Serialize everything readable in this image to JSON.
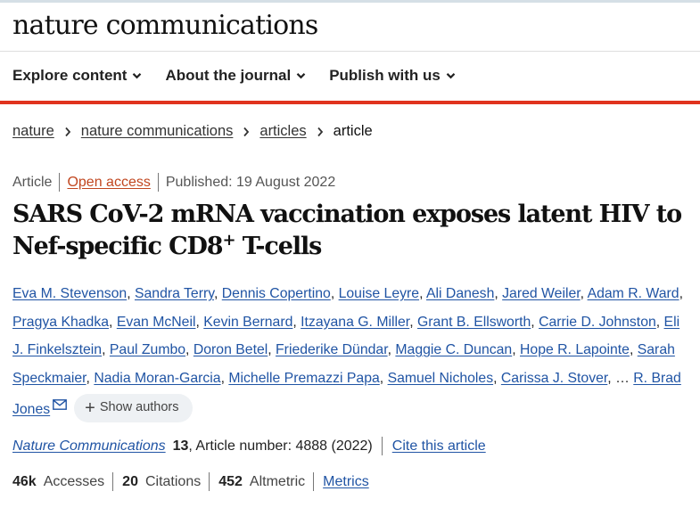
{
  "brand": {
    "name": "nature communications"
  },
  "nav": {
    "items": [
      {
        "label": "Explore content"
      },
      {
        "label": "About the journal"
      },
      {
        "label": "Publish with us"
      }
    ]
  },
  "breadcrumb": {
    "items": [
      "nature",
      "nature communications",
      "articles"
    ],
    "current": "article"
  },
  "meta": {
    "type": "Article",
    "access": "Open access",
    "published": "Published: 19 August 2022"
  },
  "title": {
    "part1": "SARS CoV-2 mRNA vaccination exposes latent HIV to Nef-specific CD8",
    "sup": "+",
    "part2": " T-cells"
  },
  "authors": {
    "list": [
      "Eva M. Stevenson",
      "Sandra Terry",
      "Dennis Copertino",
      "Louise Leyre",
      "Ali Danesh",
      "Jared Weiler",
      "Adam R. Ward",
      "Pragya Khadka",
      "Evan McNeil",
      "Kevin Bernard",
      "Itzayana G. Miller",
      "Grant B. Ellsworth",
      "Carrie D. Johnston",
      "Eli J. Finkelsztein",
      "Paul Zumbo",
      "Doron Betel",
      "Friederike Dündar",
      "Maggie C. Duncan",
      "Hope R. Lapointe",
      "Sarah Speckmaier",
      "Nadia Moran-Garcia",
      "Michelle Premazzi Papa",
      "Samuel Nicholes",
      "Carissa J. Stover"
    ],
    "ellipsis": "…",
    "corresponding": "R. Brad Jones",
    "show_label": "Show authors"
  },
  "citation": {
    "journal": "Nature Communications",
    "volume": "13",
    "article_info": ", Article number: 4888 (2022)",
    "cite_label": "Cite this article"
  },
  "metrics": {
    "accesses_count": "46k",
    "accesses_label": "Accesses",
    "citations_count": "20",
    "citations_label": "Citations",
    "altmetric_count": "452",
    "altmetric_label": "Altmetric",
    "link_label": "Metrics"
  },
  "icons": {
    "nav_chevron": "chevron-down-icon",
    "breadcrumb_separator": "chevron-right-icon",
    "corresponding_author": "mail-icon",
    "show_authors": "plus-icon"
  },
  "colors": {
    "accent_red": "#e0331e",
    "link_blue": "#2054a4",
    "open_access_orange": "#c1461f",
    "pill_background": "#eef1f4"
  }
}
